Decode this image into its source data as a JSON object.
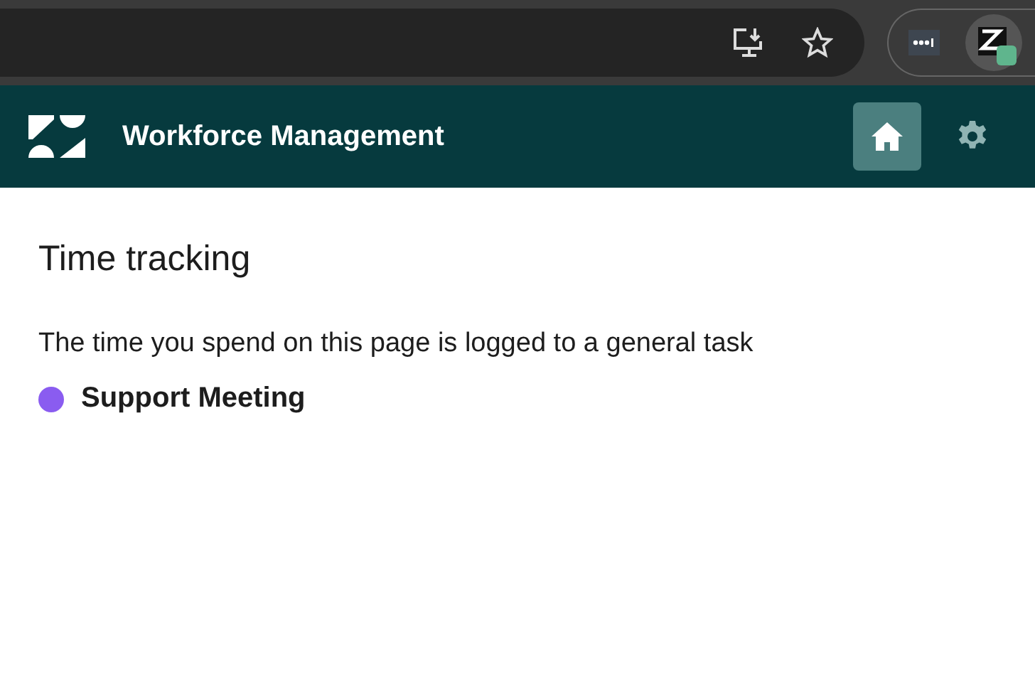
{
  "app_bar": {
    "title": "Workforce Management",
    "nav": [
      {
        "kind": "home",
        "selected": true
      },
      {
        "kind": "settings",
        "selected": false
      }
    ]
  },
  "page": {
    "title": "Time tracking",
    "description": "The time you spend on this page is logged to a general task",
    "task": {
      "name": "Support Meeting",
      "color": "#8a5cf0"
    }
  }
}
